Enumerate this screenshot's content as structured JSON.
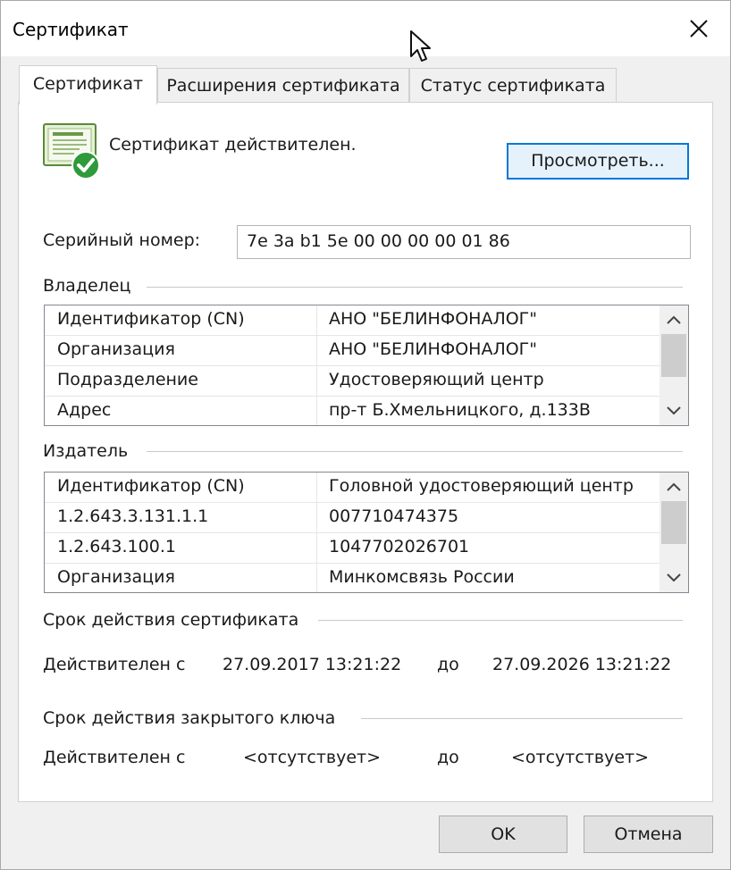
{
  "window": {
    "title": "Сертификат"
  },
  "tabs": [
    {
      "label": "Сертификат",
      "active": true
    },
    {
      "label": "Расширения сертификата",
      "active": false
    },
    {
      "label": "Статус сертификата",
      "active": false
    }
  ],
  "status": {
    "text": "Сертификат действителен.",
    "icon": "certificate-valid-icon"
  },
  "view_button": "Просмотреть...",
  "serial": {
    "label": "Серийный номер:",
    "value": "7e 3a b1 5e 00 00 00 00 01 86"
  },
  "owner": {
    "title": "Владелец",
    "rows": [
      {
        "key": "Идентификатор (CN)",
        "value": "АНО \"БЕЛИНФОНАЛОГ\""
      },
      {
        "key": "Организация",
        "value": "АНО \"БЕЛИНФОНАЛОГ\""
      },
      {
        "key": "Подразделение",
        "value": "Удостоверяющий центр"
      },
      {
        "key": "Адрес",
        "value": "пр-т Б.Хмельницкого, д.133В"
      }
    ]
  },
  "issuer": {
    "title": "Издатель",
    "rows": [
      {
        "key": "Идентификатор (CN)",
        "value": "Головной удостоверяющий центр"
      },
      {
        "key": "1.2.643.3.131.1.1",
        "value": "007710474375"
      },
      {
        "key": "1.2.643.100.1",
        "value": "1047702026701"
      },
      {
        "key": "Организация",
        "value": "Минкомсвязь России"
      }
    ]
  },
  "validity": {
    "title": "Срок действия сертификата",
    "from_label": "Действителен с",
    "from": "27.09.2017 13:21:22",
    "to_label": "до",
    "to": "27.09.2026 13:21:22"
  },
  "key_validity": {
    "title": "Срок действия закрытого ключа",
    "from_label": "Действителен с",
    "from": "<отсутствует>",
    "to_label": "до",
    "to": "<отсутствует>"
  },
  "buttons": {
    "ok": "OK",
    "cancel": "Отмена"
  },
  "colors": {
    "accent": "#0078d7",
    "icon_green": "#2e9a3a"
  }
}
